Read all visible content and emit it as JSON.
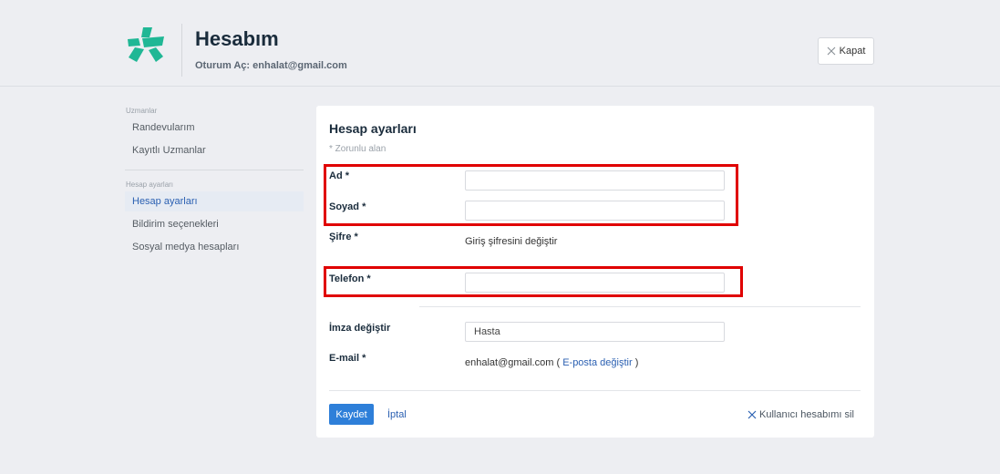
{
  "header": {
    "title": "Hesabım",
    "session": "Oturum Aç: enhalat@gmail.com",
    "close_label": "Kapat",
    "logo_icon": "docplanner-star-logo",
    "brand_color": "#20b795"
  },
  "sidebar": {
    "section1": "Uzmanlar",
    "item_appointments": "Randevularım",
    "item_saved_experts": "Kayıtlı Uzmanlar",
    "section2": "Hesap ayarları",
    "item_account_settings": "Hesap ayarları",
    "item_notifications": "Bildirim seçenekleri",
    "item_social": "Sosyal medya hesapları"
  },
  "form": {
    "title": "Hesap ayarları",
    "required_note": "* Zorunlu alan",
    "first_name_label": "Ad *",
    "first_name_value": "",
    "last_name_label": "Soyad *",
    "last_name_value": "",
    "password_label": "Şifre *",
    "password_link": "Giriş şifresini değiştir",
    "phone_label": "Telefon *",
    "phone_value": "",
    "signature_label": "İmza değiştir",
    "signature_value": "Hasta",
    "email_label": "E-mail *",
    "email_value": "enhalat@gmail.com",
    "email_paren_open": "(",
    "email_change_link": "E-posta değiştir",
    "email_paren_close": ")",
    "save_label": "Kaydet",
    "cancel_label": "İptal",
    "delete_label": "Kullanıcı hesabımı sil"
  },
  "colors": {
    "accent": "#2e7fd9",
    "link": "#2b60b2",
    "highlight": "#e00000",
    "background": "#edeef2"
  }
}
